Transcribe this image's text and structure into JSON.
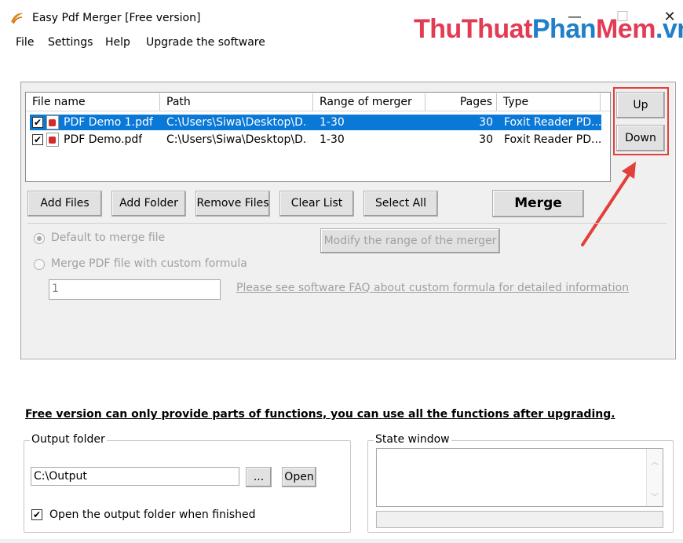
{
  "window": {
    "title": "Easy Pdf Merger [Free version]",
    "watermark": {
      "part1": "ThuThuat",
      "part2": "Phan",
      "part3": "Mem",
      "part4": ".vn"
    },
    "controls": {
      "minimize": "—",
      "maximize": "☐",
      "close": "✕"
    }
  },
  "menu": [
    "File",
    "Settings",
    "Help",
    "Upgrade the software"
  ],
  "file_list": {
    "columns": [
      "File name",
      "Path",
      "Range of merger",
      "Pages",
      "Type"
    ],
    "rows": [
      {
        "name": "PDF Demo 1.pdf",
        "path": "C:\\Users\\Siwa\\Desktop\\D...",
        "range": "1-30",
        "pages": "30",
        "type": "Foxit Reader PD...",
        "checked": true,
        "selected": true
      },
      {
        "name": "PDF Demo.pdf",
        "path": "C:\\Users\\Siwa\\Desktop\\D...",
        "range": "1-30",
        "pages": "30",
        "type": "Foxit Reader PD...",
        "checked": true,
        "selected": false
      }
    ]
  },
  "side_buttons": {
    "up": "Up",
    "down": "Down"
  },
  "actions": {
    "add_files": "Add Files",
    "add_folder": "Add Folder",
    "remove_files": "Remove Files",
    "clear_list": "Clear List",
    "select_all": "Select All",
    "merge": "Merge"
  },
  "options": {
    "default_merge": "Default to merge file",
    "custom_formula": "Merge PDF file with custom formula",
    "modify_range": "Modify the range of the merger",
    "formula_value": "1",
    "faq_link": "Please see software FAQ about custom formula for detailed information"
  },
  "free_note": "Free version can only provide parts of functions, you can use all the functions after upgrading.",
  "output": {
    "legend": "Output folder",
    "path": "C:\\Output",
    "browse": "...",
    "open": "Open",
    "open_when_finished": "Open the output folder when finished",
    "open_when_finished_checked": true
  },
  "state_window": {
    "legend": "State window"
  },
  "colors": {
    "highlight": "#0a78d7",
    "annotation": "#e2403a"
  }
}
